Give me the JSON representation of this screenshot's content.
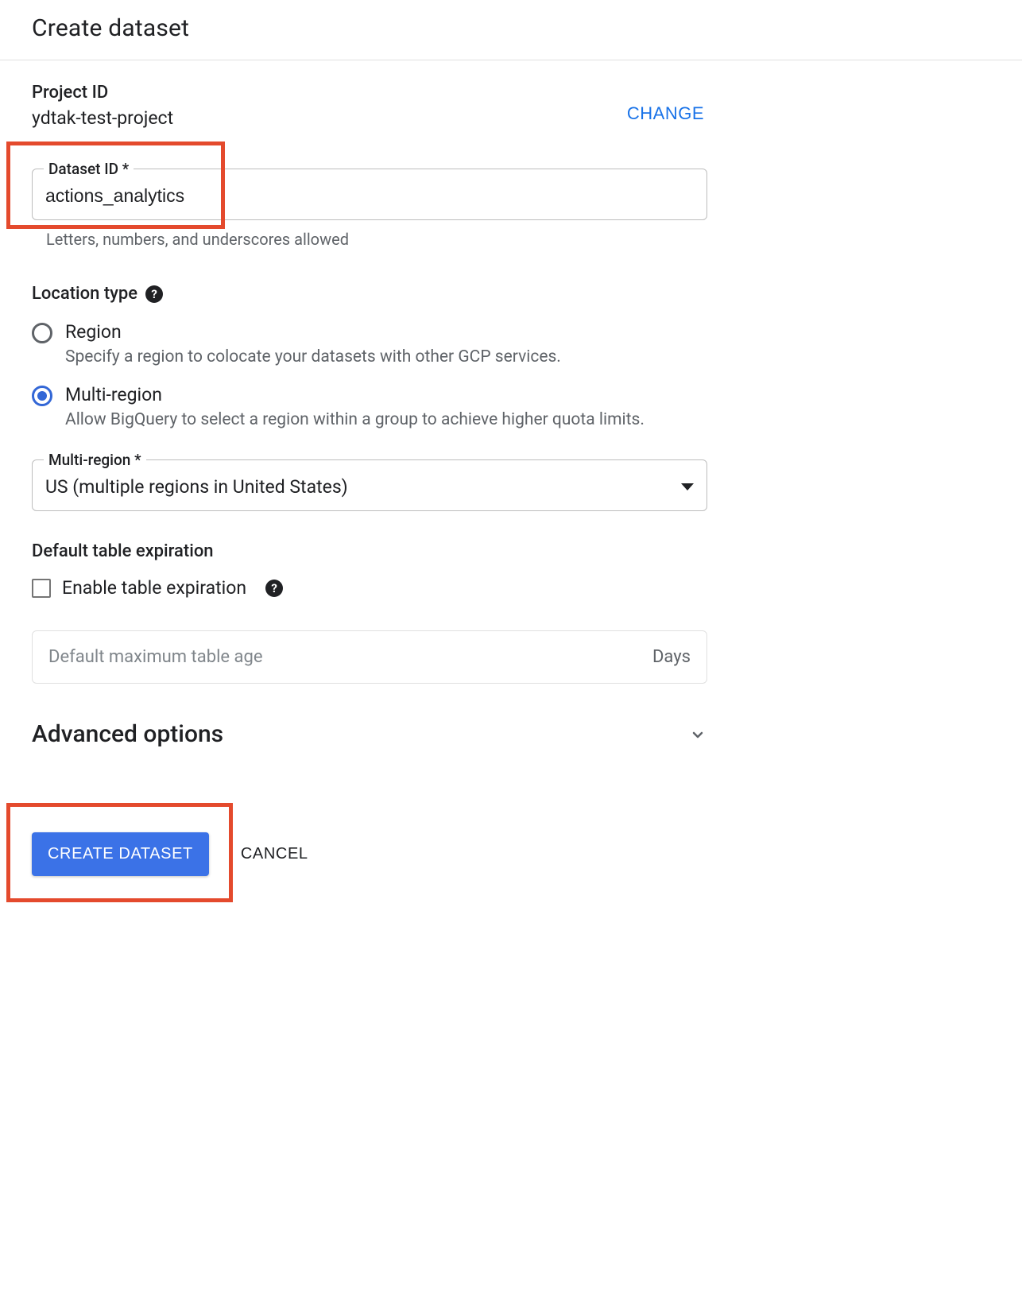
{
  "header": {
    "title": "Create dataset"
  },
  "project": {
    "label": "Project ID",
    "value": "ydtak-test-project",
    "change_label": "CHANGE"
  },
  "dataset_id": {
    "label": "Dataset ID *",
    "value": "actions_analytics",
    "helper": "Letters, numbers, and underscores allowed"
  },
  "location": {
    "heading": "Location type",
    "options": [
      {
        "label": "Region",
        "desc": "Specify a region to colocate your datasets with other GCP services."
      },
      {
        "label": "Multi-region",
        "desc": "Allow BigQuery to select a region within a group to achieve higher quota limits."
      }
    ],
    "selected_index": 1
  },
  "multi_region": {
    "label": "Multi-region *",
    "value": "US (multiple regions in United States)"
  },
  "expiration": {
    "heading": "Default table expiration",
    "checkbox_label": "Enable table expiration",
    "placeholder": "Default maximum table age",
    "suffix": "Days"
  },
  "advanced": {
    "label": "Advanced options"
  },
  "buttons": {
    "create": "CREATE DATASET",
    "cancel": "CANCEL"
  }
}
